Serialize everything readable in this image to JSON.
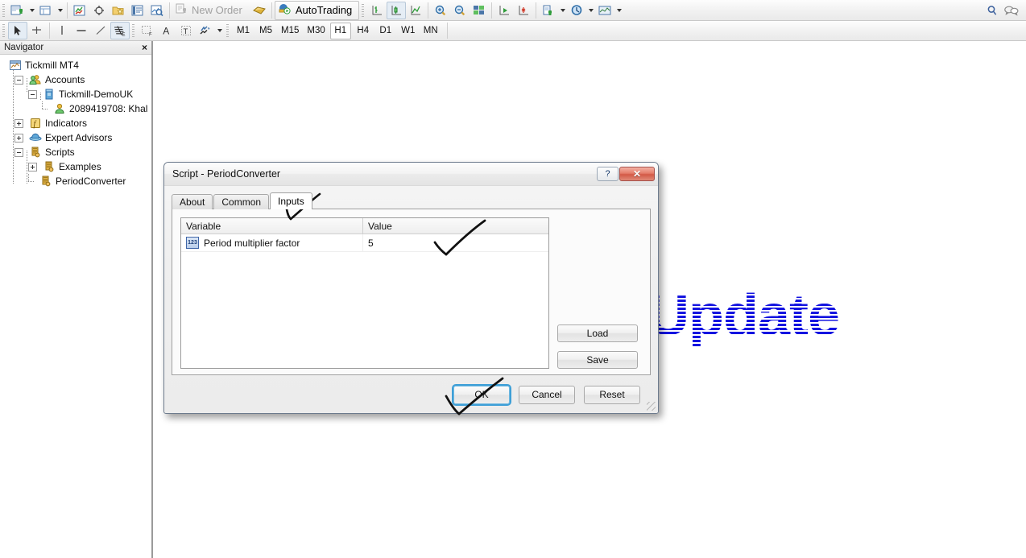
{
  "app": {
    "title": "Tickmill MT4"
  },
  "toolbar_top": {
    "items": [
      {
        "name": "new-chart-button",
        "icon": "new-chart-icon",
        "label": ""
      },
      {
        "name": "new-chart-dropdown",
        "icon": "chevron-down-icon",
        "label": ""
      },
      {
        "name": "profiles-button",
        "icon": "profiles-icon",
        "label": ""
      },
      {
        "name": "profiles-dropdown",
        "icon": "chevron-down-icon",
        "label": ""
      },
      {
        "name": "market-watch-button",
        "icon": "market-watch-icon",
        "label": ""
      },
      {
        "name": "data-window-button",
        "icon": "crosshair-target-icon",
        "label": ""
      },
      {
        "name": "navigator-button",
        "icon": "folder-star-icon",
        "label": ""
      },
      {
        "name": "terminal-button",
        "icon": "terminal-list-icon",
        "label": ""
      },
      {
        "name": "strategy-tester-button",
        "icon": "magnifier-chart-icon",
        "label": ""
      },
      {
        "name": "new-order-button",
        "icon": "new-order-icon",
        "label": "New Order"
      },
      {
        "name": "metaeditor-button",
        "icon": "metaeditor-icon",
        "label": ""
      },
      {
        "name": "autotrading-button",
        "icon": "autotrading-icon",
        "label": "AutoTrading"
      },
      {
        "name": "bar-chart-button",
        "icon": "bar-chart-icon",
        "label": ""
      },
      {
        "name": "candlestick-chart-button",
        "icon": "candlestick-icon",
        "label": ""
      },
      {
        "name": "line-chart-button",
        "icon": "line-chart-icon",
        "label": ""
      },
      {
        "name": "zoom-in-button",
        "icon": "zoom-in-icon",
        "label": ""
      },
      {
        "name": "zoom-out-button",
        "icon": "zoom-out-icon",
        "label": ""
      },
      {
        "name": "tile-windows-button",
        "icon": "tile-windows-icon",
        "label": ""
      },
      {
        "name": "auto-scroll-button",
        "icon": "auto-scroll-icon",
        "label": ""
      },
      {
        "name": "chart-shift-button",
        "icon": "chart-shift-icon",
        "label": ""
      },
      {
        "name": "indicators-button",
        "icon": "indicators-add-icon",
        "label": ""
      },
      {
        "name": "indicators-dropdown",
        "icon": "chevron-down-icon",
        "label": ""
      },
      {
        "name": "periods-button",
        "icon": "clock-icon",
        "label": ""
      },
      {
        "name": "periods-dropdown",
        "icon": "chevron-down-icon",
        "label": ""
      },
      {
        "name": "templates-button",
        "icon": "templates-icon",
        "label": ""
      },
      {
        "name": "templates-dropdown",
        "icon": "chevron-down-icon",
        "label": ""
      }
    ],
    "right_items": [
      {
        "name": "search-icon",
        "label": ""
      },
      {
        "name": "chat-icon",
        "label": ""
      }
    ],
    "new_order_label": "New Order",
    "autotrading_label": "AutoTrading"
  },
  "toolbar_second": {
    "tools": [
      {
        "name": "cursor-tool",
        "icon": "cursor-arrow-icon",
        "active": true
      },
      {
        "name": "crosshair-tool",
        "icon": "crosshair-icon",
        "active": false
      },
      {
        "name": "vertical-line-tool",
        "icon": "vertical-line-icon",
        "active": false
      },
      {
        "name": "horizontal-line-tool",
        "icon": "horizontal-line-icon",
        "active": false
      },
      {
        "name": "trendline-tool",
        "icon": "trendline-icon",
        "active": false
      },
      {
        "name": "fibonacci-tool",
        "icon": "fibonacci-icon",
        "active": false
      },
      {
        "name": "text-label-tool",
        "icon": "text-f-icon",
        "active": false
      },
      {
        "name": "text-tool",
        "icon": "text-a-icon",
        "active": false
      },
      {
        "name": "text-box-tool",
        "icon": "text-box-icon",
        "active": false
      },
      {
        "name": "shapes-tool",
        "icon": "arrows-shapes-icon",
        "active": false
      }
    ],
    "periods": [
      {
        "label": "M1",
        "active": false
      },
      {
        "label": "M5",
        "active": false
      },
      {
        "label": "M15",
        "active": false
      },
      {
        "label": "M30",
        "active": false
      },
      {
        "label": "H1",
        "active": true
      },
      {
        "label": "H4",
        "active": false
      },
      {
        "label": "D1",
        "active": false
      },
      {
        "label": "W1",
        "active": false
      },
      {
        "label": "MN",
        "active": false
      }
    ]
  },
  "navigator": {
    "title": "Navigator",
    "close_label": "×",
    "tree": [
      {
        "label": "Tickmill MT4",
        "icon": "terminal-icon",
        "depth": 0,
        "expander": null
      },
      {
        "label": "Accounts",
        "icon": "accounts-icon",
        "depth": 1,
        "expander": "minus"
      },
      {
        "label": "Tickmill-DemoUK",
        "icon": "server-icon",
        "depth": 2,
        "expander": "minus"
      },
      {
        "label": "2089419708: Khal",
        "icon": "account-person-icon",
        "depth": 3,
        "expander": null
      },
      {
        "label": "Indicators",
        "icon": "indicator-f-icon",
        "depth": 1,
        "expander": "plus"
      },
      {
        "label": "Expert Advisors",
        "icon": "expert-advisor-icon",
        "depth": 1,
        "expander": "plus"
      },
      {
        "label": "Scripts",
        "icon": "script-icon",
        "depth": 1,
        "expander": "minus"
      },
      {
        "label": "Examples",
        "icon": "script-icon",
        "depth": 2,
        "expander": "plus"
      },
      {
        "label": "PeriodConverter",
        "icon": "script-icon",
        "depth": 2,
        "expander": null
      }
    ]
  },
  "chart": {
    "watermark_text": "Update"
  },
  "dialog": {
    "title": "Script - PeriodConverter",
    "help_label": "?",
    "close_label": "✕",
    "tabs": [
      {
        "label": "About",
        "active": false
      },
      {
        "label": "Common",
        "active": false
      },
      {
        "label": "Inputs",
        "active": true
      }
    ],
    "grid": {
      "headers": [
        "Variable",
        "Value"
      ],
      "rows": [
        {
          "type_icon": "123",
          "variable": "Period multiplier factor",
          "value": "5"
        }
      ]
    },
    "side_buttons": [
      {
        "label": "Load",
        "name": "load-button"
      },
      {
        "label": "Save",
        "name": "save-button"
      }
    ],
    "footer_buttons": [
      {
        "label": "OK",
        "name": "ok-button",
        "default": true
      },
      {
        "label": "Cancel",
        "name": "cancel-button",
        "default": false
      },
      {
        "label": "Reset",
        "name": "reset-button",
        "default": false
      }
    ]
  },
  "annotations": [
    {
      "name": "arrow-to-inputs-tab",
      "target": "inputs-tab"
    },
    {
      "name": "checkmark-on-value",
      "target": "value-cell"
    },
    {
      "name": "check-arrow-on-ok",
      "target": "ok-button"
    }
  ],
  "colors": {
    "accent_blue": "#1414e0",
    "focus_blue": "#3e9fd7",
    "close_red": "#d35a46",
    "toolbar_bg": "#f2f2f2",
    "panel_border": "#9a9a9a"
  }
}
